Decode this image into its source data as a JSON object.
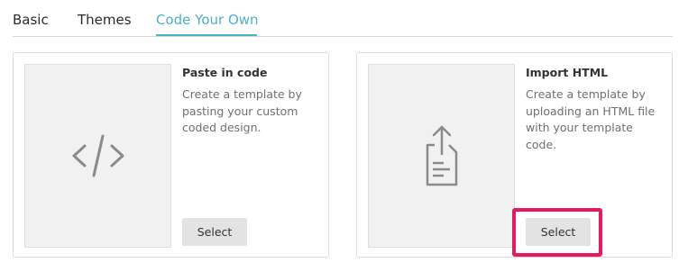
{
  "tabs": [
    {
      "label": "Basic",
      "active": false
    },
    {
      "label": "Themes",
      "active": false
    },
    {
      "label": "Code Your Own",
      "active": true
    }
  ],
  "cards": [
    {
      "title": "Paste in code",
      "description": "Create a template by pasting your custom coded design.",
      "button_label": "Select",
      "icon": "code-icon"
    },
    {
      "title": "Import HTML",
      "description": "Create a template by uploading an HTML file with your template code.",
      "button_label": "Select",
      "icon": "upload-file-icon"
    }
  ],
  "colors": {
    "accent": "#4bb0c8",
    "highlight": "#e8185f",
    "icon": "#8a8a8a"
  }
}
